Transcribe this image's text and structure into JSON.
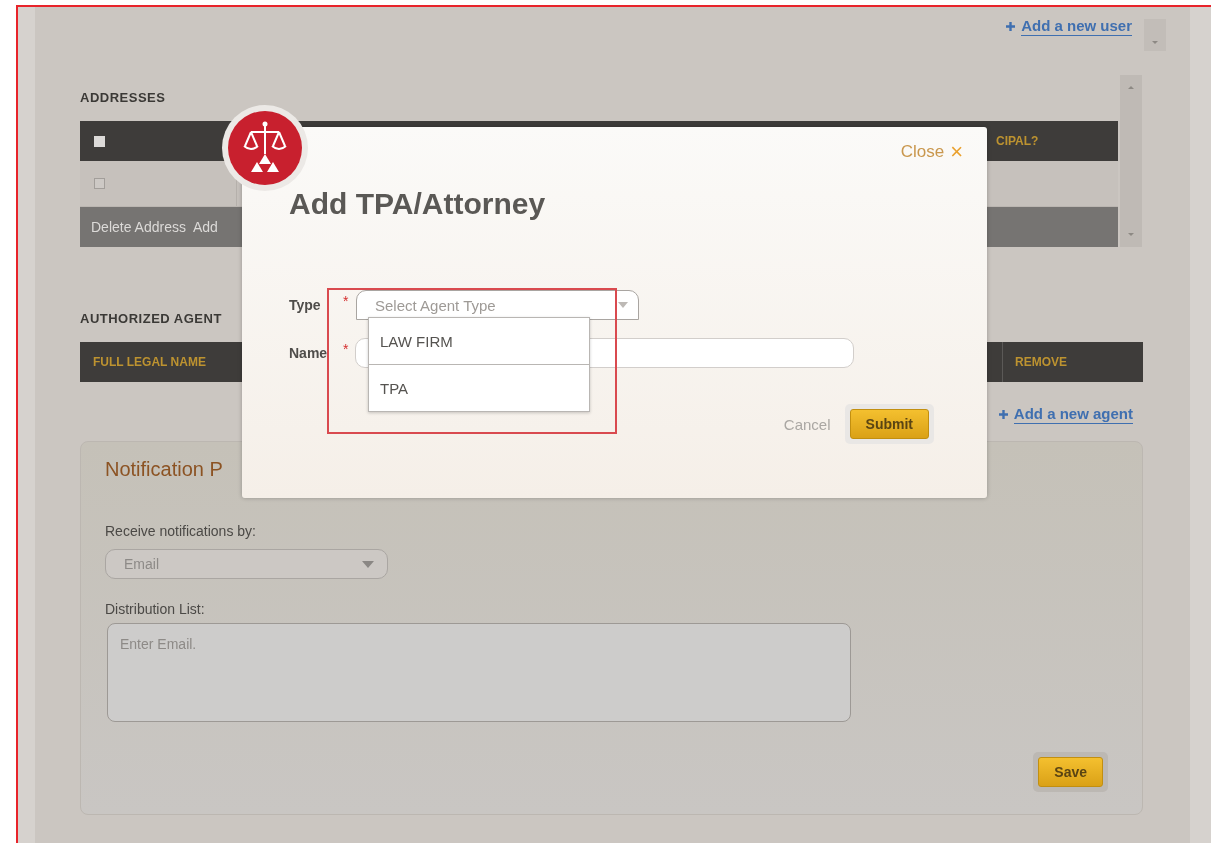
{
  "page": {
    "add_user_link": "Add a new user",
    "addresses": {
      "heading": "ADDRESSES",
      "header_checked": false,
      "last_column": "CIPAL?",
      "rows": [
        {
          "checked": false
        }
      ],
      "actions": [
        "Delete Address",
        "Add"
      ]
    },
    "agents": {
      "heading": "AUTHORIZED AGENT",
      "columns": [
        "FULL LEGAL NAME",
        "REMOVE"
      ],
      "add_link": "Add a new agent"
    },
    "notifications": {
      "title": "Notification P",
      "method_label": "Receive notifications by:",
      "method_value": "Email",
      "list_label": "Distribution List:",
      "list_placeholder": "Enter Email.",
      "save": "Save"
    }
  },
  "dialog": {
    "close": "Close",
    "close_glyph": "×",
    "title": "Add TPA/Attorney",
    "fields": [
      {
        "kind": "select",
        "label": "Type",
        "marker": "*",
        "placeholder": "Select Agent Type",
        "expanded": true
      },
      {
        "kind": "text",
        "label": "Name",
        "marker": "*"
      }
    ],
    "options": [
      {
        "label": "LAW FIRM",
        "selected": false
      },
      {
        "label": "TPA",
        "selected": false
      }
    ],
    "cancel": "Cancel",
    "submit": "Submit"
  }
}
